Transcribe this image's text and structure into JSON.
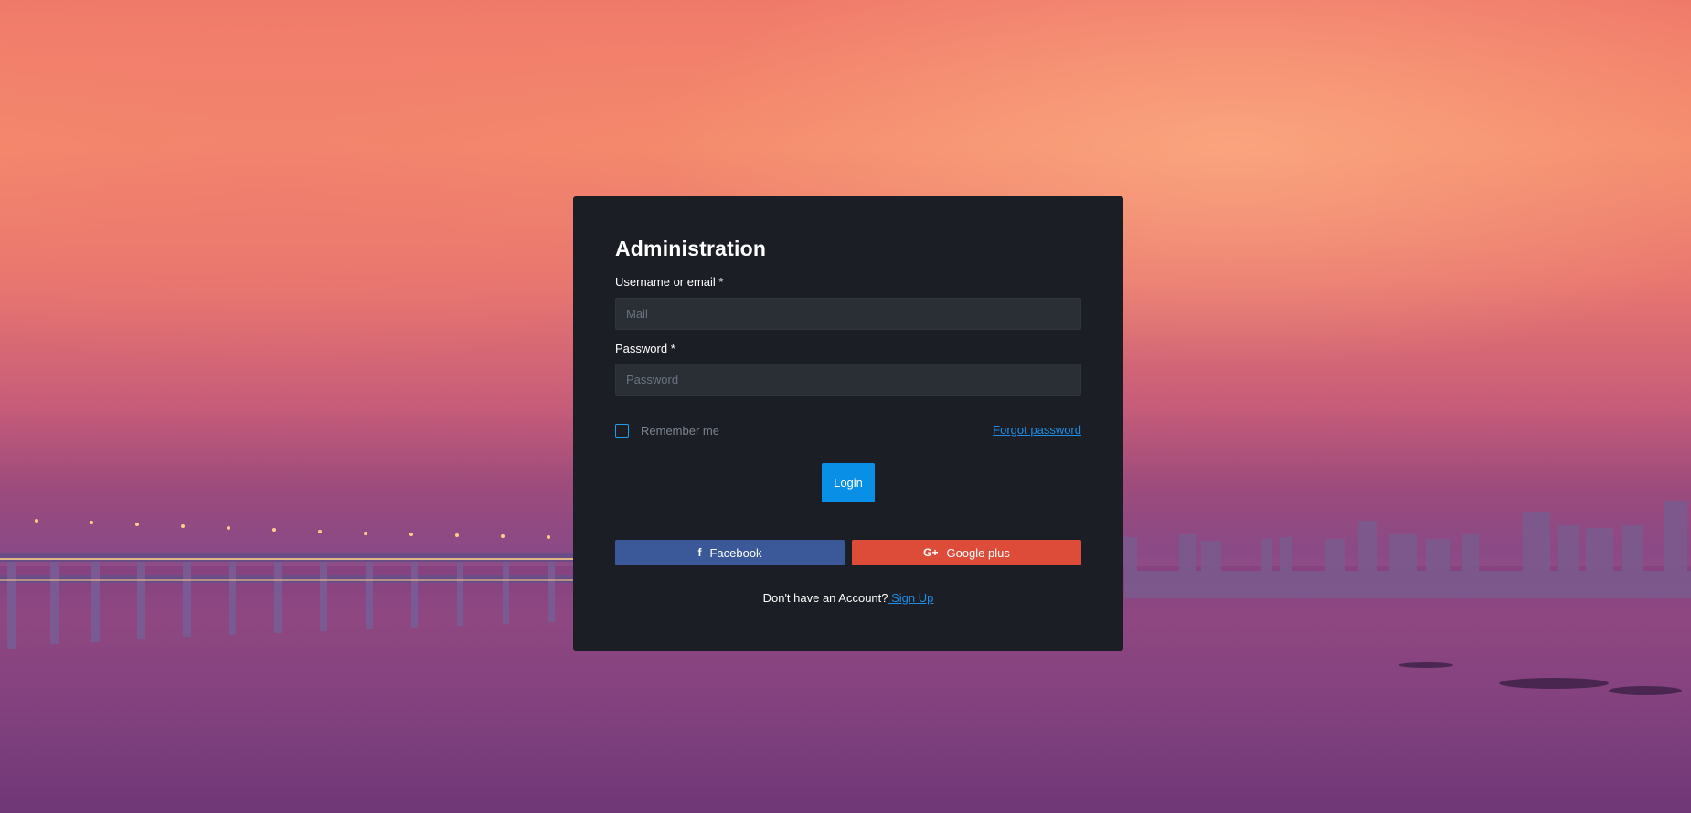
{
  "login": {
    "title": "Administration",
    "username_label": "Username or email *",
    "username_placeholder": "Mail",
    "password_label": "Password *",
    "password_placeholder": "Password",
    "remember_label": "Remember me",
    "forgot_label": "Forgot password",
    "login_button": "Login",
    "facebook_label": "Facebook",
    "google_label": "Google plus",
    "no_account_text": "Don't have an Account?",
    "signup_label": " Sign Up"
  },
  "icons": {
    "facebook": "facebook-icon",
    "google": "google-plus-icon"
  },
  "colors": {
    "card_bg": "#1b1e24",
    "accent": "#0a8fe6",
    "facebook": "#3b5998",
    "google": "#dd4b39"
  }
}
